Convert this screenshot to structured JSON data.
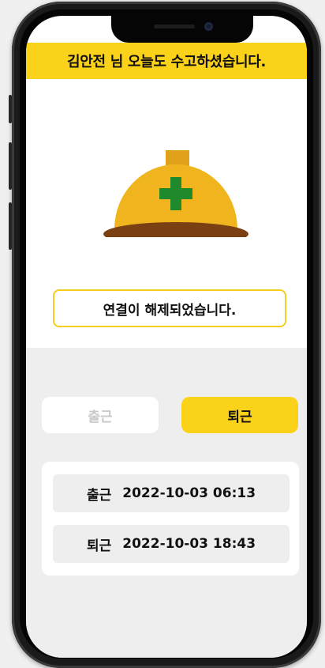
{
  "banner": {
    "text": "김안전 님 오늘도 수고하셨습니다."
  },
  "status": {
    "text": "연결이 해제되었습니다."
  },
  "buttons": {
    "check_in": "출근",
    "check_out": "퇴근"
  },
  "records": [
    {
      "label": "출근",
      "value": "2022-10-03 06:13"
    },
    {
      "label": "퇴근",
      "value": "2022-10-03 18:43"
    }
  ],
  "colors": {
    "accent": "#fbd21a",
    "helmet": "#f0b41e",
    "helmet_brim": "#7a3f12",
    "cross": "#1f8a2c"
  },
  "icons": {
    "helmet": "safety-helmet-icon"
  }
}
